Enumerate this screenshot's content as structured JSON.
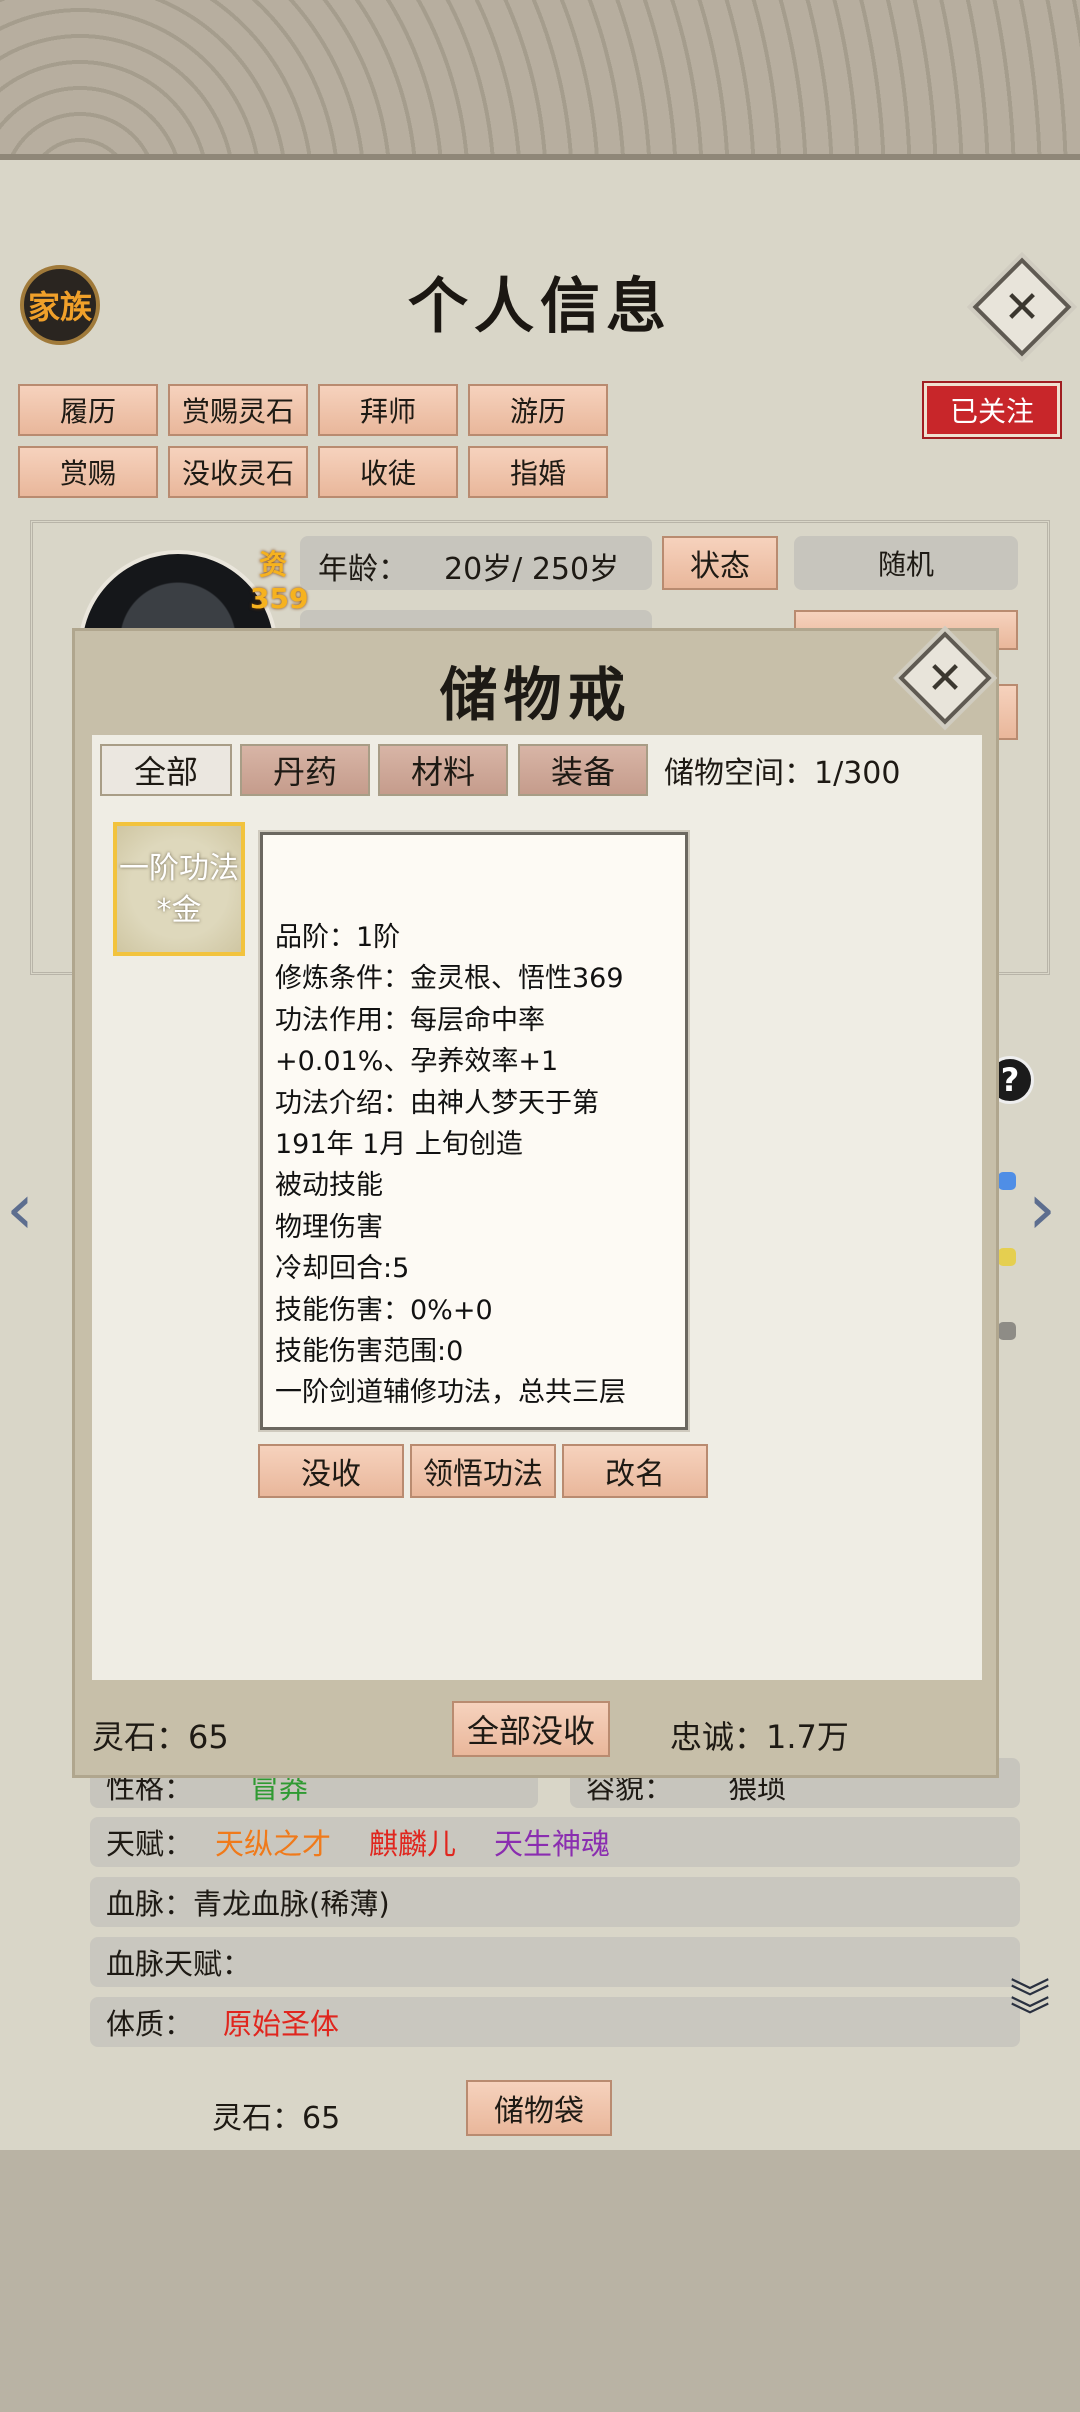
{
  "header": {
    "title": "个人信息",
    "family_badge": "家族",
    "followed": "已关注"
  },
  "actions_row1": [
    "履历",
    "赏赐灵石",
    "拜师",
    "游历"
  ],
  "actions_row2": [
    "赏赐",
    "没收灵石",
    "收徒",
    "指婚"
  ],
  "profile": {
    "aptitude_label": "资",
    "aptitude_value": "359",
    "age_label": "年龄：",
    "age_value": "20岁/ 250岁",
    "status_button": "状态",
    "random_label": "随机"
  },
  "traits": {
    "personality_label": "性格：",
    "personality_value": "冒莽",
    "appearance_label": "容貌：",
    "appearance_value": "猥琐",
    "talent_label": "天赋：",
    "talents": [
      {
        "name": "天纵之才",
        "color": "#f07a1a"
      },
      {
        "name": "麒麟儿",
        "color": "#e0261e"
      },
      {
        "name": "天生神魂",
        "color": "#8a2db0"
      }
    ],
    "bloodline_label": "血脉：",
    "bloodline_value": "青龙血脉(稀薄)",
    "bloodline_talent_label": "血脉天赋：",
    "physique_label": "体质：",
    "physique_value": "原始圣体",
    "physique_color": "#e0261e"
  },
  "bottom": {
    "stones": "灵石：65",
    "bag_button": "储物袋"
  },
  "modal": {
    "title": "储物戒",
    "tabs": [
      "全部",
      "丹药",
      "材料",
      "装备"
    ],
    "active_tab": "全部",
    "storage_label": "储物空间：1/300",
    "item_slot_line1": "一阶功法",
    "item_slot_line2": "*金",
    "detail_lines": [
      "品阶：1阶",
      "修炼条件：金灵根、悟性369",
      "功法作用：每层命中率",
      "+0.01%、孕养效率+1",
      "功法介绍：由神人梦天于第",
      "191年 1月 上旬创造",
      "被动技能",
      "物理伤害",
      "冷却回合:5",
      "技能伤害：0%+0",
      "技能伤害范围:0",
      "一阶剑道辅修功法，总共三层"
    ],
    "item_buttons": [
      "没收",
      "领悟功法",
      "改名"
    ],
    "footer_stones": "灵石：65",
    "confiscate_all": "全部没收",
    "loyalty": "忠诚：1.7万"
  }
}
